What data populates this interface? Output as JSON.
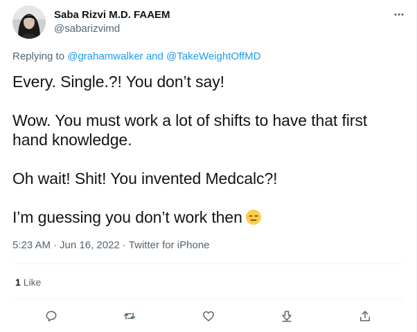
{
  "author": {
    "display_name": "Saba Rizvi M.D. FAAEM",
    "handle": "@sabarizvimd"
  },
  "reply_context": {
    "prefix": "Replying to",
    "user1": "@grahamwalker",
    "conjunction": "and",
    "user2": "@TakeWeightOffMD"
  },
  "body": {
    "paragraphs": [
      "Every. Single.?! You don’t say!",
      "Wow. You must work a lot of shifts to have that first hand knowledge.",
      "Oh wait! Shit! You invented Medcalc?!",
      "I’m guessing you don’t work then"
    ],
    "trailing_emoji": "expressionless-face-emoji"
  },
  "meta": {
    "time": "5:23 AM",
    "separator": "·",
    "date": "Jun 16, 2022",
    "client": "Twitter for iPhone"
  },
  "engagement": {
    "like_count": "1",
    "like_label": "Like"
  },
  "actions": {
    "reply_icon": "speech-bubble-icon",
    "retweet_icon": "retweet-icon",
    "like_icon": "heart-icon",
    "bookmark_icon": "download-arrow-icon",
    "share_icon": "share-up-arrow-icon"
  },
  "colors": {
    "text_primary": "#0f1419",
    "text_secondary": "#536471",
    "link": "#1d9bf0",
    "divider": "#eff3f4"
  }
}
